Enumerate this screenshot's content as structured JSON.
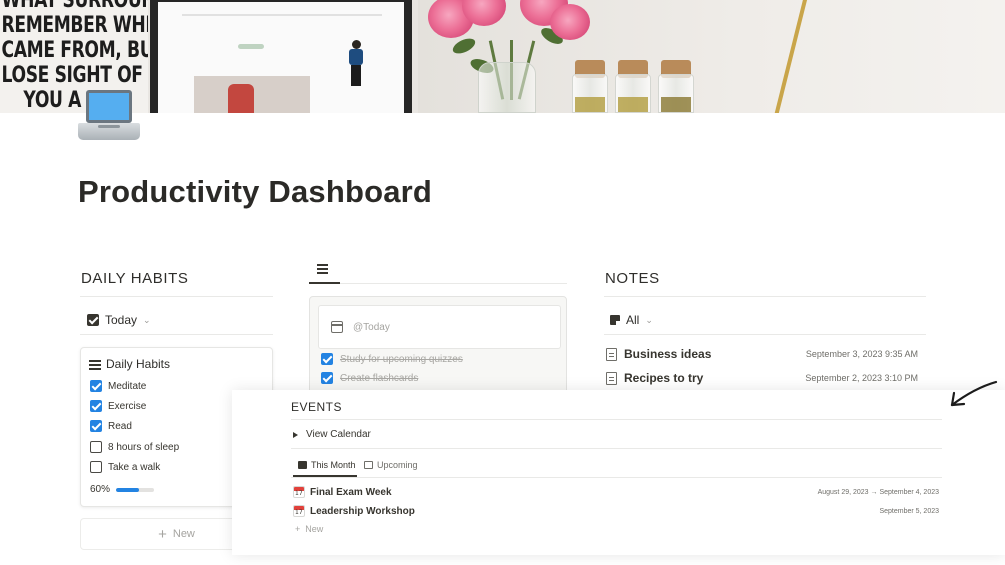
{
  "cover": {
    "poster_lines": [
      "WHAT SURROUN",
      "REMEMBER WHI",
      "CAME FROM, BU",
      "LOSE SIGHT OF",
      "YOU A"
    ]
  },
  "page": {
    "icon": "laptop-icon",
    "title": "Productivity Dashboard"
  },
  "habits": {
    "heading": "DAILY HABITS",
    "view_label": "Today",
    "card_title": "Daily Habits",
    "items": [
      {
        "label": "Meditate",
        "checked": true
      },
      {
        "label": "Exercise",
        "checked": true
      },
      {
        "label": "Read",
        "checked": true
      },
      {
        "label": "8 hours of sleep",
        "checked": false
      },
      {
        "label": "Take a walk",
        "checked": false
      }
    ],
    "progress_text": "60%",
    "progress_value": 0.6,
    "new_label": "New"
  },
  "todo": {
    "menu_icon": "menu-icon",
    "date_placeholder": "@Today",
    "items": [
      {
        "label": "Study for upcoming quizzes",
        "checked": true
      },
      {
        "label": "Create flashcards",
        "checked": true
      }
    ]
  },
  "notes": {
    "heading": "NOTES",
    "view_label": "All",
    "items": [
      {
        "title": "Business ideas",
        "date": "September 3, 2023 9:35 AM"
      },
      {
        "title": "Recipes to try",
        "date": "September 2, 2023 3:10 PM"
      }
    ]
  },
  "events": {
    "heading": "EVENTS",
    "toggle_label": "View Calendar",
    "tabs": [
      {
        "label": "This Month",
        "active": true
      },
      {
        "label": "Upcoming",
        "active": false
      }
    ],
    "items": [
      {
        "title": "Final Exam Week",
        "date": "August 29, 2023 → September 4, 2023"
      },
      {
        "title": "Leadership Workshop",
        "date": "September 5, 2023"
      }
    ],
    "new_label": "New"
  },
  "colors": {
    "accent_blue": "#2383e2",
    "text": "#37352f",
    "muted": "#a5a4a0"
  }
}
